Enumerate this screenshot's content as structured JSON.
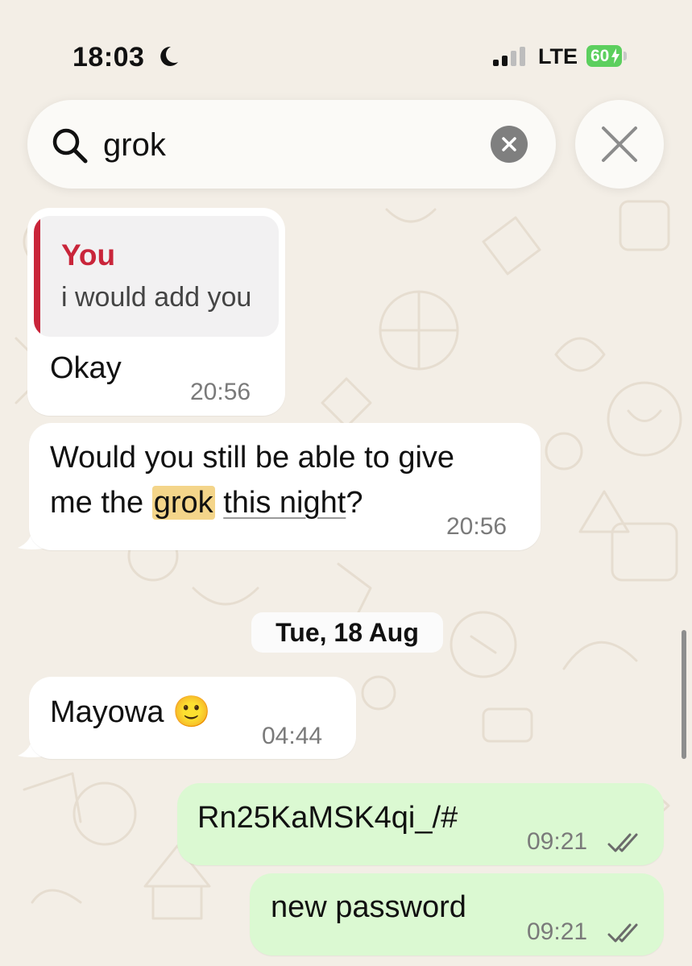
{
  "status_bar": {
    "time": "18:03",
    "network": "LTE",
    "battery_level": "60"
  },
  "search": {
    "query": "grok"
  },
  "messages": [
    {
      "direction": "incoming",
      "quoted": {
        "author": "You",
        "text": "i would add you"
      },
      "text": "Okay",
      "time": "20:56"
    },
    {
      "direction": "incoming",
      "line1": "Would you still be able to give",
      "line2_before": "me the",
      "line2_highlight": "grok",
      "line2_underlined": "this night",
      "line2_after": "?",
      "time": "20:56"
    },
    {
      "direction": "incoming",
      "text": "Mayowa 🙂",
      "time": "04:44"
    },
    {
      "direction": "outgoing",
      "text": "Rn25KaMSK4qi_/#",
      "time": "09:21",
      "status": "read"
    },
    {
      "direction": "outgoing",
      "text": "new password",
      "time": "09:21",
      "status": "read"
    }
  ],
  "date_separator": "Tue, 18 Aug",
  "colors": {
    "incoming_bubble": "#ffffff",
    "outgoing_bubble": "#dbf9d2",
    "highlight": "#f4d58a",
    "quote_accent": "#c9253a",
    "battery": "#5ccf5e"
  }
}
